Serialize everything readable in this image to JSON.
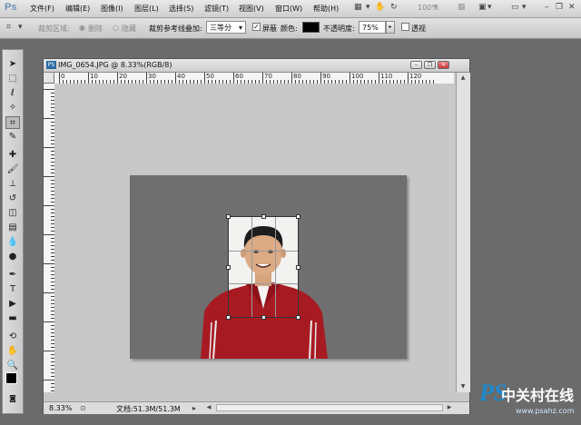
{
  "app": {
    "logo": "Ps"
  },
  "menubar": {
    "items": [
      "文件(F)",
      "编辑(E)",
      "图像(I)",
      "图层(L)",
      "选择(S)",
      "滤镜(T)",
      "视图(V)",
      "窗口(W)",
      "帮助(H)"
    ],
    "zoom_value": "100%"
  },
  "options": {
    "crop_area_label": "裁剪区域:",
    "delete_label": "删除",
    "hide_label": "隐藏",
    "overlay_label": "裁剪参考线叠加:",
    "overlay_value": "三等分",
    "shield_label": "屏蔽",
    "shield_checked": "✓",
    "color_label": "颜色:",
    "color_value": "#000000",
    "opacity_label": "不透明度:",
    "opacity_value": "75%",
    "perspective_label": "透视"
  },
  "document": {
    "title": "IMG_0654.JPG @ 8.33%(RGB/8)",
    "icon_label": "PS",
    "ruler_top_labels": [
      "0",
      "10",
      "20",
      "30",
      "40",
      "50",
      "60",
      "70",
      "80",
      "90",
      "100",
      "110",
      "120"
    ],
    "status_zoom": "8.33%",
    "status_doc": "文档:51.3M/51.3M"
  },
  "colors": {
    "accent": "#2d6aa6",
    "canvas_bg": "#c8c8c8",
    "photo_bg": "#6f6f6f",
    "jacket_red": "#a81a22",
    "watermark_blue": "#1b8ad0"
  },
  "watermark": {
    "ps": "PS",
    "text": "中关村在线",
    "url": "www.psahz.com"
  }
}
